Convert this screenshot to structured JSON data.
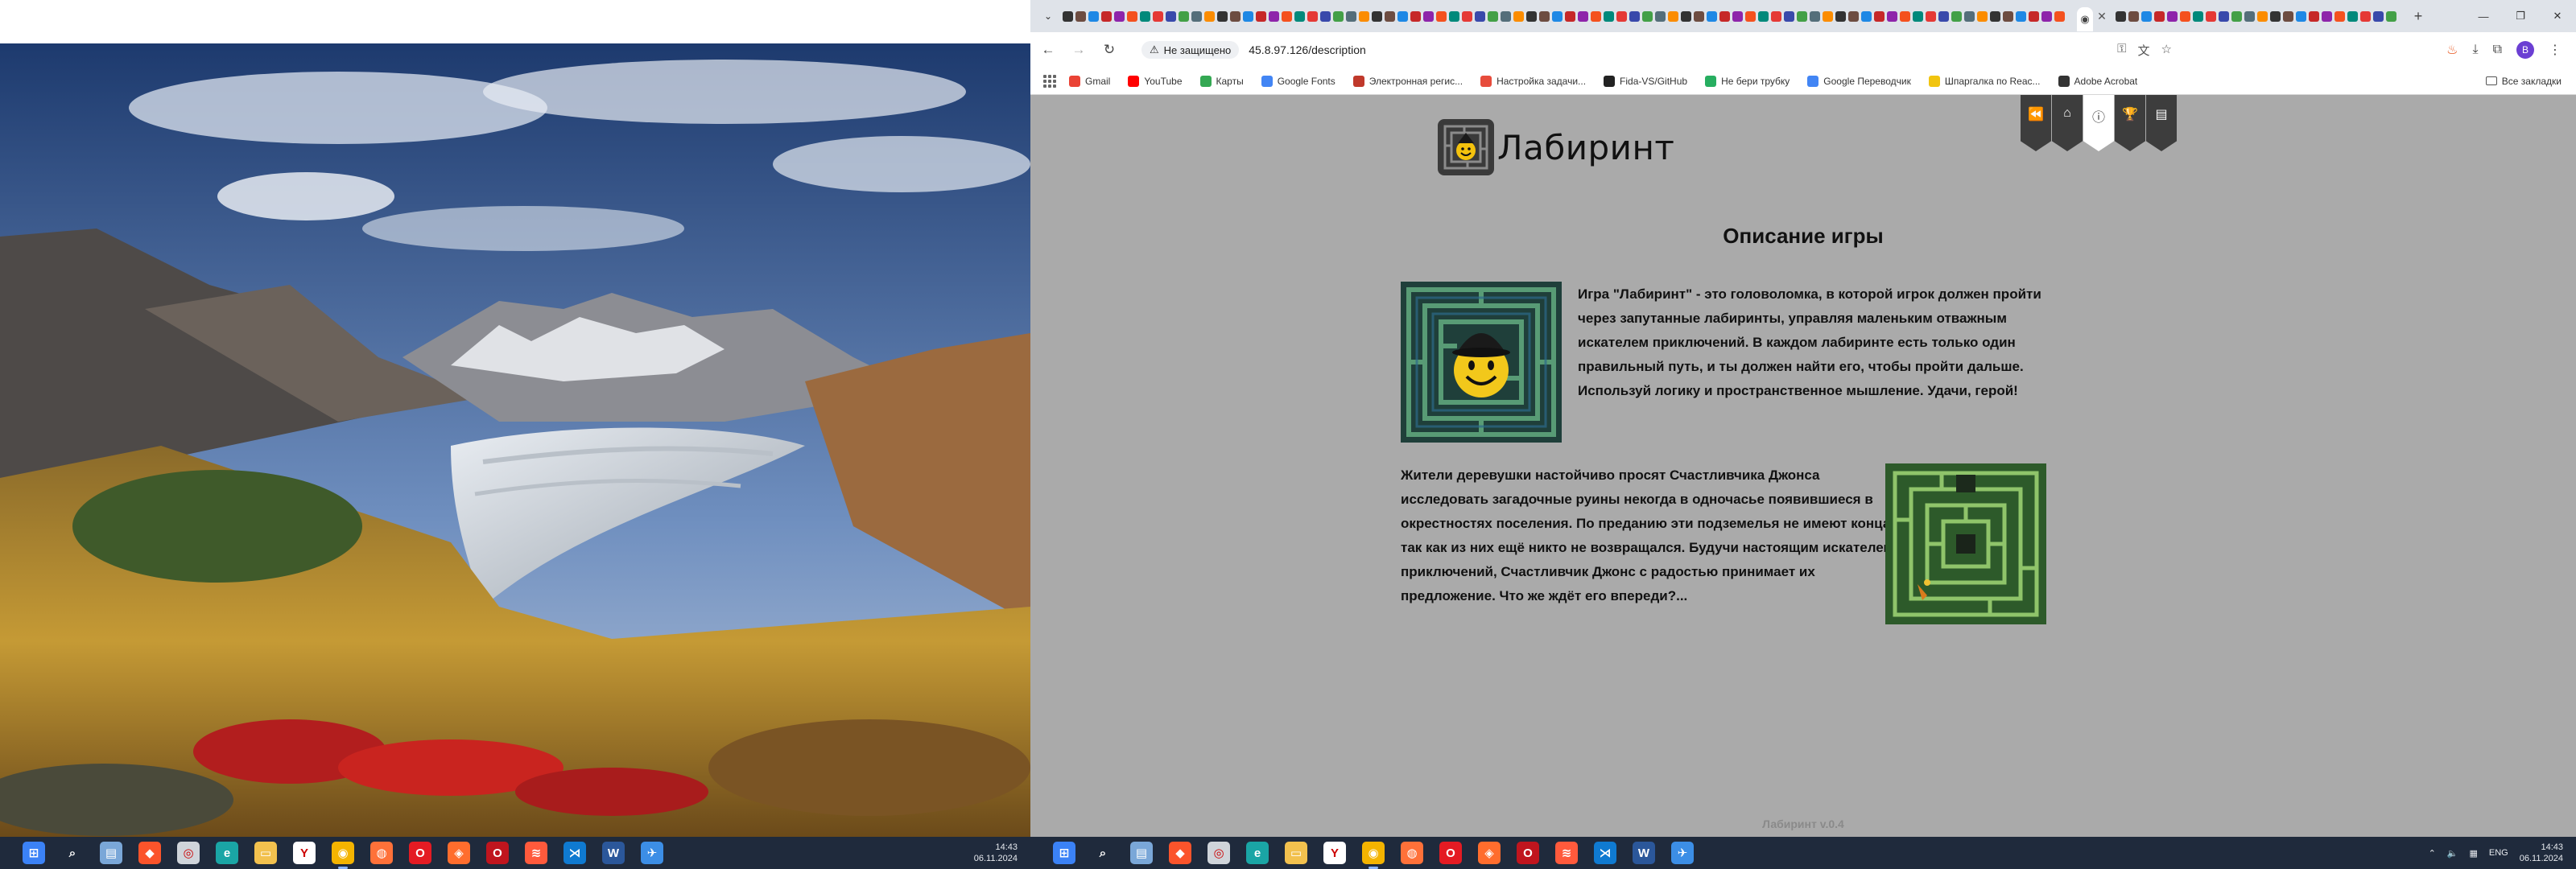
{
  "browser": {
    "security_label": "Не защищено",
    "url": "45.8.97.126/description",
    "all_bookmarks": "Все закладки",
    "profile_initial": "В"
  },
  "bookmarks": [
    {
      "label": "Gmail",
      "color": "#ea4335"
    },
    {
      "label": "YouTube",
      "color": "#ff0000"
    },
    {
      "label": "Карты",
      "color": "#34a853"
    },
    {
      "label": "Google Fonts",
      "color": "#4285f4"
    },
    {
      "label": "Электронная регис...",
      "color": "#c0392b"
    },
    {
      "label": "Настройка задачи...",
      "color": "#e74c3c"
    },
    {
      "label": "Fida-VS/GitHub",
      "color": "#222222"
    },
    {
      "label": "Не бери трубку",
      "color": "#27ae60"
    },
    {
      "label": "Google Переводчик",
      "color": "#4285f4"
    },
    {
      "label": "Шпаргалка по Reac...",
      "color": "#f1c40f"
    },
    {
      "label": "Adobe Acrobat",
      "color": "#333333"
    }
  ],
  "page": {
    "logo_text": "Лабиринт",
    "title": "Описание игры",
    "paragraph1": "Игра \"Лабиринт\" - это головоломка, в которой игрок должен пройти через запутанные лабиринты, управляя маленьким отважным искателем приключений. В каждом лабиринте есть только один правильный путь, и ты должен найти его, чтобы пройти дальше. Используй логику и пространственное мышление. Удачи, герой!",
    "paragraph2": "Жители деревушки настойчиво просят Счастливчика Джонса исследовать загадочные руины некогда в одночасье появившиеся в окрестностях поселения. По преданию эти подземелья не имеют конца, так как из них ещё никто не возвращался. Будучи настоящим искателем приключений, Счастливчик Джонс с радостью принимает их предложение. Что же ждёт его впереди?...",
    "version": "Лабиринт v.0.4"
  },
  "nav_ribbons": [
    {
      "name": "back-ribbon",
      "icon": "rewind-icon",
      "glyph": "⏪"
    },
    {
      "name": "home-ribbon",
      "icon": "home-icon",
      "glyph": "⌂"
    },
    {
      "name": "info-ribbon",
      "icon": "info-icon",
      "glyph": "ⓘ",
      "active": true
    },
    {
      "name": "trophy-ribbon",
      "icon": "trophy-icon",
      "glyph": "🏆"
    },
    {
      "name": "document-ribbon",
      "icon": "document-icon",
      "glyph": "▤"
    }
  ],
  "taskbar": {
    "left_clock_time": "14:43",
    "left_clock_date": "06.11.2024",
    "right_clock_time": "14:43",
    "right_clock_date": "06.11.2024",
    "language": "ENG"
  },
  "colors": {
    "page_background": "#aaaaaa",
    "ribbon": "#3d3d3d",
    "ribbon_active": "#ffffff",
    "taskbar": "#1f2a3c"
  }
}
